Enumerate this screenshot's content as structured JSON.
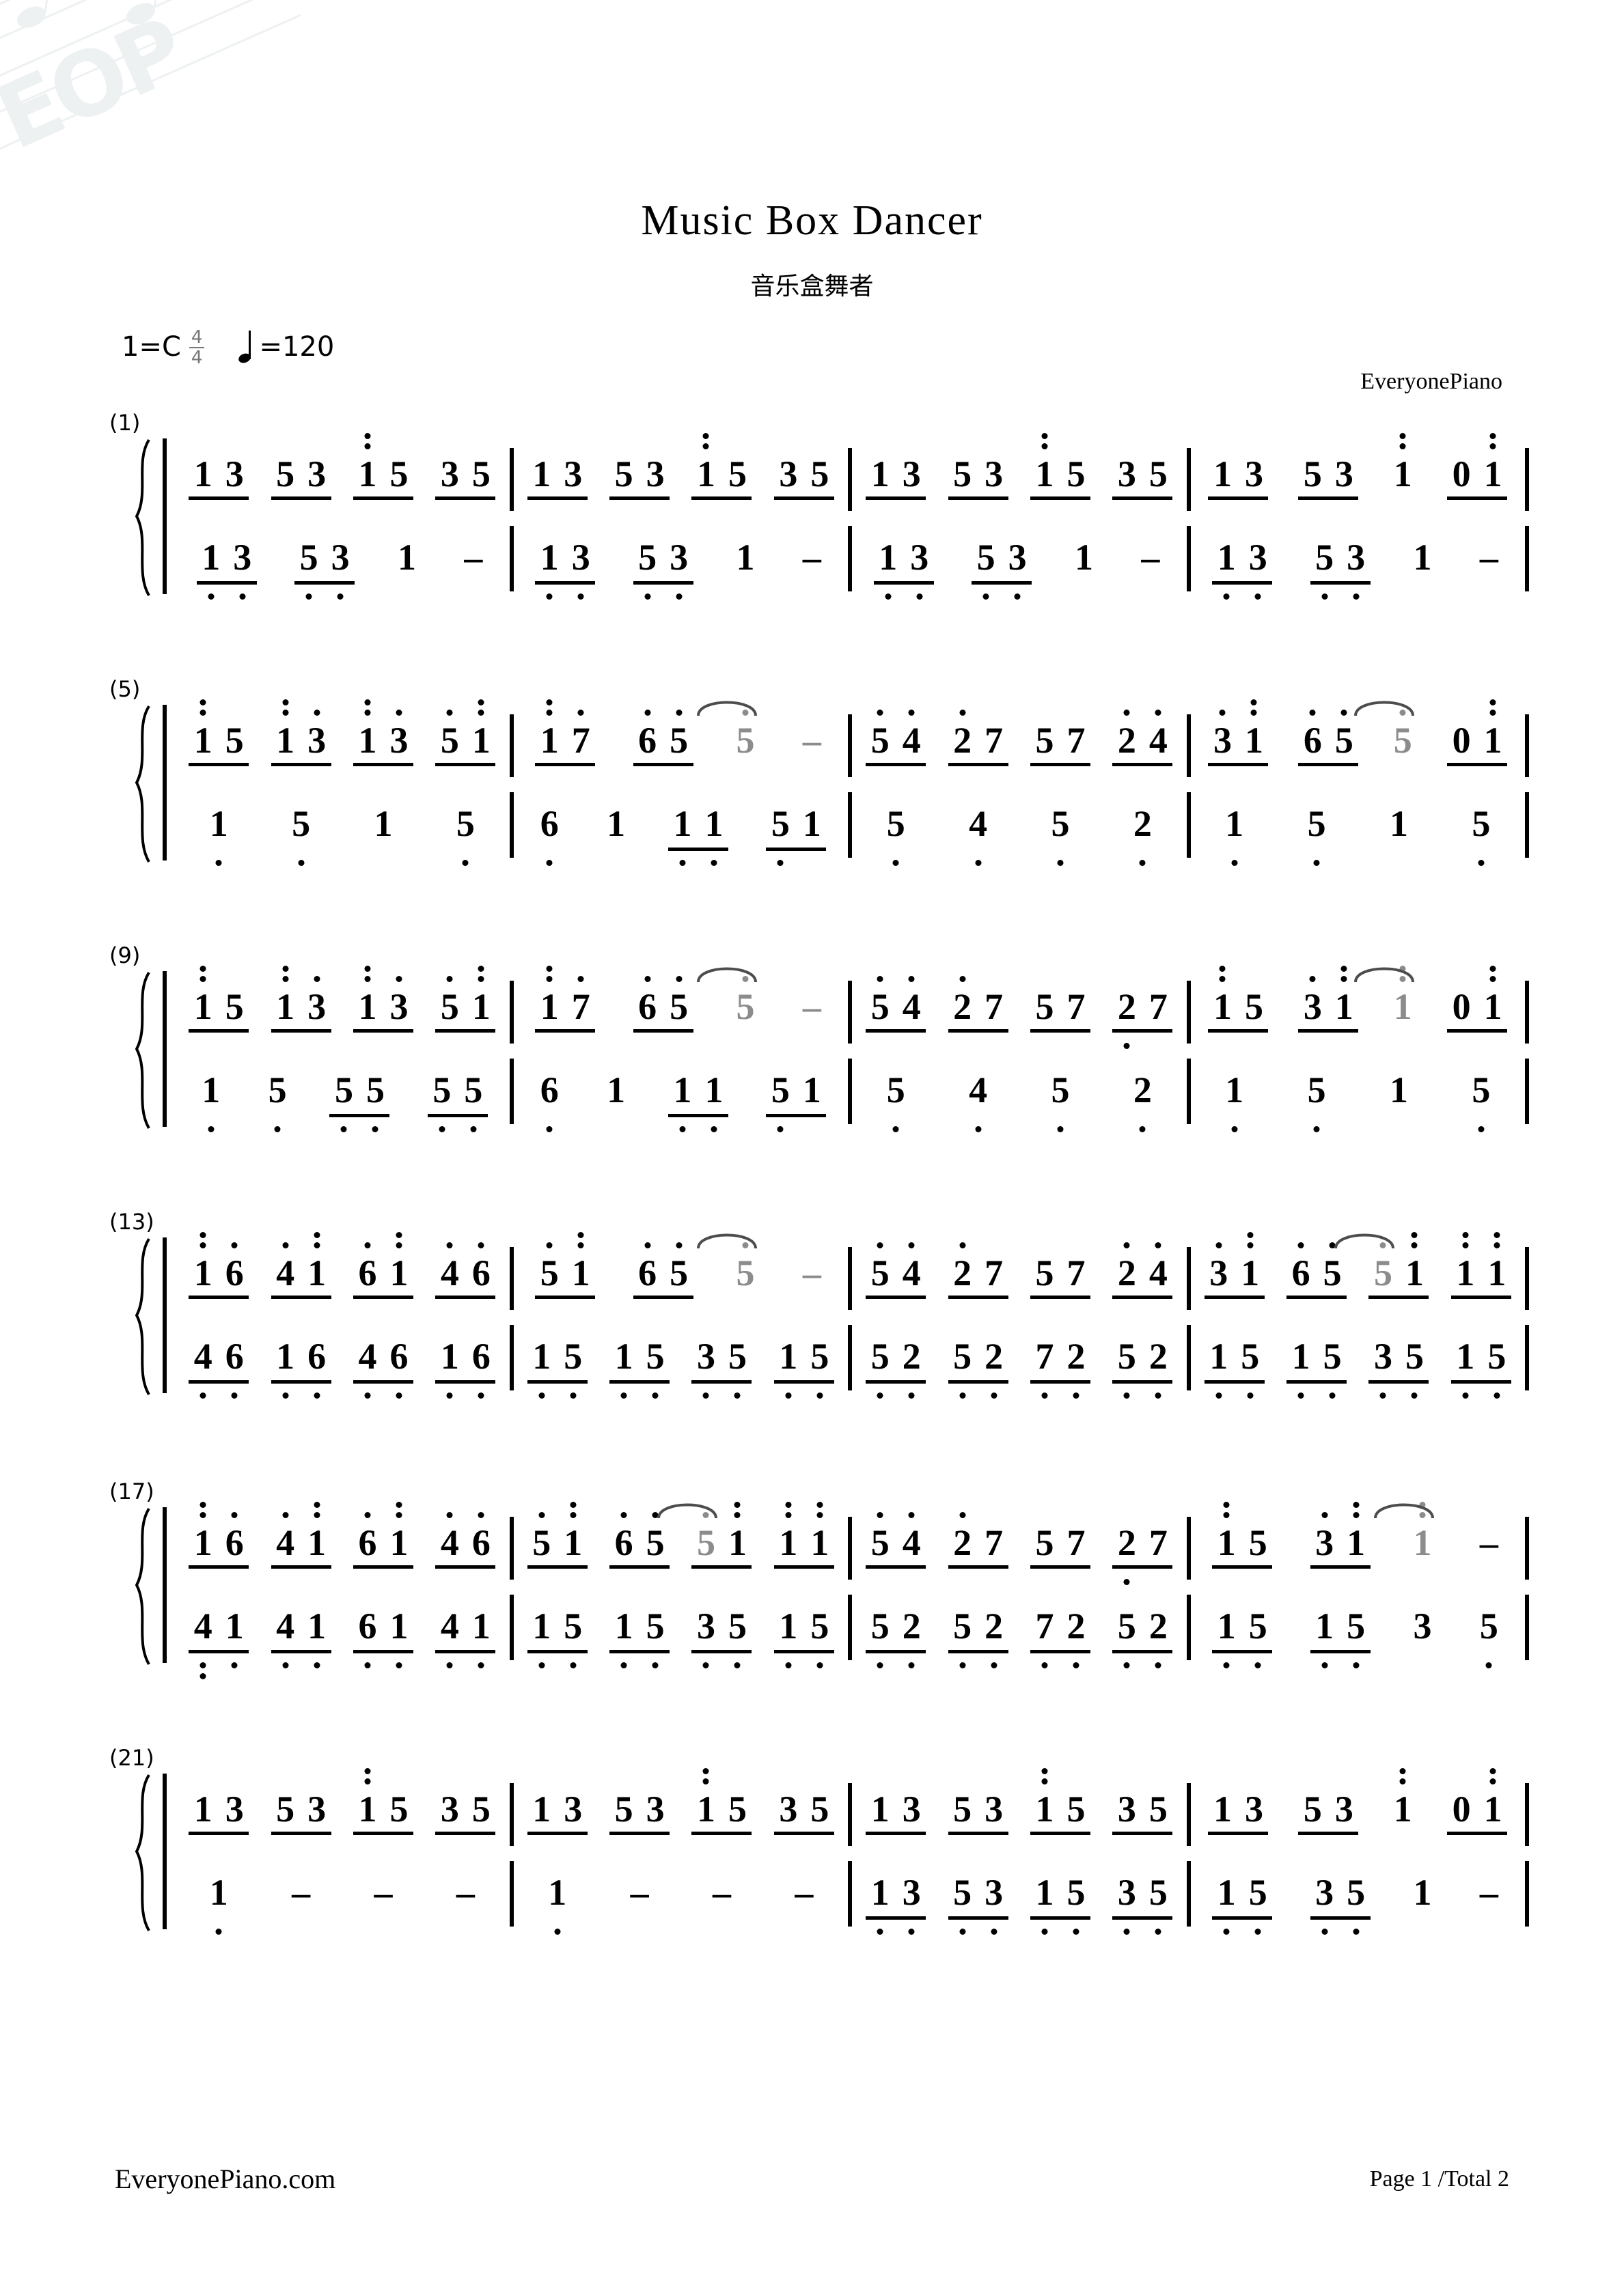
{
  "header": {
    "title": "Music Box Dancer",
    "subtitle": "音乐盒舞者",
    "key_label": "1=C",
    "time_num": "4",
    "time_den": "4",
    "tempo_label": "=120",
    "credit": "EveryonePiano"
  },
  "footer": {
    "site": "EveryonePiano.com",
    "page": "Page 1 /Total 2"
  },
  "notation": {
    "type": "jianpu",
    "instrument": "piano-two-staff",
    "systems": [
      {
        "number": "(1)",
        "treble": [
          {
            "groups": [
              [
                "1",
                "3"
              ],
              [
                "5",
                "3"
              ],
              [
                "i*",
                "5"
              ],
              [
                "3",
                "5"
              ]
            ]
          },
          {
            "groups": [
              [
                "1",
                "3"
              ],
              [
                "5",
                "3"
              ],
              [
                "i*",
                "5"
              ],
              [
                "3",
                "5"
              ]
            ]
          },
          {
            "groups": [
              [
                "1",
                "3"
              ],
              [
                "5",
                "3"
              ],
              [
                "i*",
                "5"
              ],
              [
                "3",
                "5"
              ]
            ]
          },
          {
            "groups": [
              [
                "1",
                "3"
              ],
              [
                "5",
                "3"
              ],
              [
                "i*"
              ],
              [
                "0",
                "i*"
              ]
            ]
          }
        ],
        "bass": [
          {
            "groups": [
              [
                "1_",
                "3_"
              ],
              [
                "5_",
                "3_"
              ],
              [
                "1"
              ],
              [
                "-"
              ]
            ]
          },
          {
            "groups": [
              [
                "1_",
                "3_"
              ],
              [
                "5_",
                "3_"
              ],
              [
                "1"
              ],
              [
                "-"
              ]
            ]
          },
          {
            "groups": [
              [
                "1_",
                "3_"
              ],
              [
                "5_",
                "3_"
              ],
              [
                "1"
              ],
              [
                "-"
              ]
            ]
          },
          {
            "groups": [
              [
                "1_",
                "3_"
              ],
              [
                "5_",
                "3_"
              ],
              [
                "1"
              ],
              [
                "-"
              ]
            ]
          }
        ]
      },
      {
        "number": "(5)",
        "treble": [
          {
            "groups": [
              [
                "i*",
                "5"
              ],
              [
                "i*",
                "3*"
              ],
              [
                "i*",
                "3*"
              ],
              [
                "5*",
                "i*"
              ]
            ]
          },
          {
            "groups": [
              [
                "i**",
                "7*"
              ],
              [
                "6*",
                "5*"
              ],
              [
                "5*~"
              ],
              [
                "-~"
              ]
            ]
          },
          {
            "groups": [
              [
                "5*",
                "4*"
              ],
              [
                "2*",
                "7"
              ],
              [
                "5",
                "7"
              ],
              [
                "2*",
                "4*"
              ]
            ]
          },
          {
            "groups": [
              [
                "3*",
                "i*"
              ],
              [
                "6*",
                "5*"
              ],
              [
                "5*~"
              ],
              [
                "0",
                "i*"
              ]
            ]
          }
        ],
        "bass": [
          {
            "groups": [
              [
                "1_"
              ],
              [
                "5_"
              ],
              [
                "1"
              ],
              [
                "5_"
              ]
            ]
          },
          {
            "groups": [
              [
                "6_"
              ],
              [
                "1"
              ],
              [
                "1_",
                "1_"
              ],
              [
                "5_",
                "1"
              ]
            ]
          },
          {
            "groups": [
              [
                "5_"
              ],
              [
                "4_"
              ],
              [
                "5_"
              ],
              [
                "2_"
              ]
            ]
          },
          {
            "groups": [
              [
                "1_"
              ],
              [
                "5_"
              ],
              [
                "1"
              ],
              [
                "5_"
              ]
            ]
          }
        ]
      },
      {
        "number": "(9)",
        "treble": [
          {
            "groups": [
              [
                "i*",
                "5"
              ],
              [
                "i*",
                "3*"
              ],
              [
                "i*",
                "3*"
              ],
              [
                "5*",
                "i*"
              ]
            ]
          },
          {
            "groups": [
              [
                "i**",
                "7*"
              ],
              [
                "6*",
                "5*"
              ],
              [
                "5*~"
              ],
              [
                "-~"
              ]
            ]
          },
          {
            "groups": [
              [
                "5*",
                "4*"
              ],
              [
                "2*",
                "7"
              ],
              [
                "5",
                "7"
              ],
              [
                "2_",
                "7"
              ]
            ]
          },
          {
            "groups": [
              [
                "i*",
                "5"
              ],
              [
                "3*",
                "i*"
              ],
              [
                "i*~"
              ],
              [
                "0",
                "i*"
              ]
            ]
          }
        ],
        "bass": [
          {
            "groups": [
              [
                "1_"
              ],
              [
                "5_"
              ],
              [
                "5_",
                "5_"
              ],
              [
                "5_",
                "5_"
              ]
            ]
          },
          {
            "groups": [
              [
                "6_"
              ],
              [
                "1"
              ],
              [
                "1_",
                "1_"
              ],
              [
                "5_",
                "1"
              ]
            ]
          },
          {
            "groups": [
              [
                "5_"
              ],
              [
                "4_"
              ],
              [
                "5_"
              ],
              [
                "2_"
              ]
            ]
          },
          {
            "groups": [
              [
                "1_"
              ],
              [
                "5_"
              ],
              [
                "1"
              ],
              [
                "5_"
              ]
            ]
          }
        ]
      },
      {
        "number": "(13)",
        "treble": [
          {
            "groups": [
              [
                "i**",
                "6*"
              ],
              [
                "4*",
                "i*"
              ],
              [
                "6*",
                "i*"
              ],
              [
                "4*",
                "6*"
              ]
            ]
          },
          {
            "groups": [
              [
                "5*",
                "i*"
              ],
              [
                "6*",
                "5*"
              ],
              [
                "5*~"
              ],
              [
                "-~"
              ]
            ]
          },
          {
            "groups": [
              [
                "5*",
                "4*"
              ],
              [
                "2*",
                "7"
              ],
              [
                "5",
                "7"
              ],
              [
                "2*",
                "4*"
              ]
            ]
          },
          {
            "groups": [
              [
                "3*",
                "i*"
              ],
              [
                "6*",
                "5*"
              ],
              [
                "5*~",
                "i*"
              ],
              [
                "i*",
                "i*"
              ]
            ]
          }
        ],
        "bass": [
          {
            "groups": [
              [
                "4_",
                "6_"
              ],
              [
                "1_",
                "6_"
              ],
              [
                "4_",
                "6_"
              ],
              [
                "1_",
                "6_"
              ]
            ]
          },
          {
            "groups": [
              [
                "1_",
                "5_"
              ],
              [
                "1_",
                "5_"
              ],
              [
                "3_",
                "5_"
              ],
              [
                "1_",
                "5_"
              ]
            ]
          },
          {
            "groups": [
              [
                "5_",
                "2_"
              ],
              [
                "5_",
                "2_"
              ],
              [
                "7_",
                "2_"
              ],
              [
                "5_",
                "2_"
              ]
            ]
          },
          {
            "groups": [
              [
                "1_",
                "5_"
              ],
              [
                "1_",
                "5_"
              ],
              [
                "3_",
                "5_"
              ],
              [
                "1_",
                "5_"
              ]
            ]
          }
        ]
      },
      {
        "number": "(17)",
        "treble": [
          {
            "groups": [
              [
                "i**",
                "6*"
              ],
              [
                "4*",
                "i*"
              ],
              [
                "6*",
                "i*"
              ],
              [
                "4*",
                "6*"
              ]
            ]
          },
          {
            "groups": [
              [
                "5*",
                "i*"
              ],
              [
                "6*",
                "5*"
              ],
              [
                "5*~",
                "i*"
              ],
              [
                "i*",
                "i*"
              ]
            ]
          },
          {
            "groups": [
              [
                "5*",
                "4*"
              ],
              [
                "2*",
                "7"
              ],
              [
                "5",
                "7"
              ],
              [
                "2_",
                "7"
              ]
            ]
          },
          {
            "groups": [
              [
                "i*",
                "5"
              ],
              [
                "3*",
                "i*"
              ],
              [
                "i*~"
              ],
              [
                "-"
              ]
            ]
          }
        ],
        "bass": [
          {
            "groups": [
              [
                "4__",
                "1_"
              ],
              [
                "4_",
                "1_"
              ],
              [
                "6_",
                "1_"
              ],
              [
                "4_",
                "1_"
              ]
            ]
          },
          {
            "groups": [
              [
                "1_",
                "5_"
              ],
              [
                "1_",
                "5_"
              ],
              [
                "3_",
                "5_"
              ],
              [
                "1_",
                "5_"
              ]
            ]
          },
          {
            "groups": [
              [
                "5_",
                "2_"
              ],
              [
                "5_",
                "2_"
              ],
              [
                "7_",
                "2_"
              ],
              [
                "5_",
                "2_"
              ]
            ]
          },
          {
            "groups": [
              [
                "1_",
                "5_"
              ],
              [
                "1_",
                "5_"
              ],
              [
                "3"
              ],
              [
                "5_"
              ]
            ]
          }
        ]
      },
      {
        "number": "(21)",
        "treble": [
          {
            "groups": [
              [
                "1",
                "3"
              ],
              [
                "5",
                "3"
              ],
              [
                "i*",
                "5"
              ],
              [
                "3",
                "5"
              ]
            ]
          },
          {
            "groups": [
              [
                "1",
                "3"
              ],
              [
                "5",
                "3"
              ],
              [
                "i*",
                "5"
              ],
              [
                "3",
                "5"
              ]
            ]
          },
          {
            "groups": [
              [
                "1",
                "3"
              ],
              [
                "5",
                "3"
              ],
              [
                "i*",
                "5"
              ],
              [
                "3",
                "5"
              ]
            ]
          },
          {
            "groups": [
              [
                "1",
                "3"
              ],
              [
                "5",
                "3"
              ],
              [
                "i*"
              ],
              [
                "0",
                "i*"
              ]
            ]
          }
        ],
        "bass": [
          {
            "groups": [
              [
                "1_"
              ],
              [
                "-"
              ],
              [
                "-"
              ],
              [
                "-"
              ]
            ]
          },
          {
            "groups": [
              [
                "1_"
              ],
              [
                "-"
              ],
              [
                "-"
              ],
              [
                "-"
              ]
            ]
          },
          {
            "groups": [
              [
                "1_",
                "3_"
              ],
              [
                "5_",
                "3_"
              ],
              [
                "1_",
                "5_"
              ],
              [
                "3_",
                "5_"
              ]
            ]
          },
          {
            "groups": [
              [
                "1_",
                "5_"
              ],
              [
                "3_",
                "5_"
              ],
              [
                "1"
              ],
              [
                "-"
              ]
            ]
          }
        ]
      }
    ]
  }
}
